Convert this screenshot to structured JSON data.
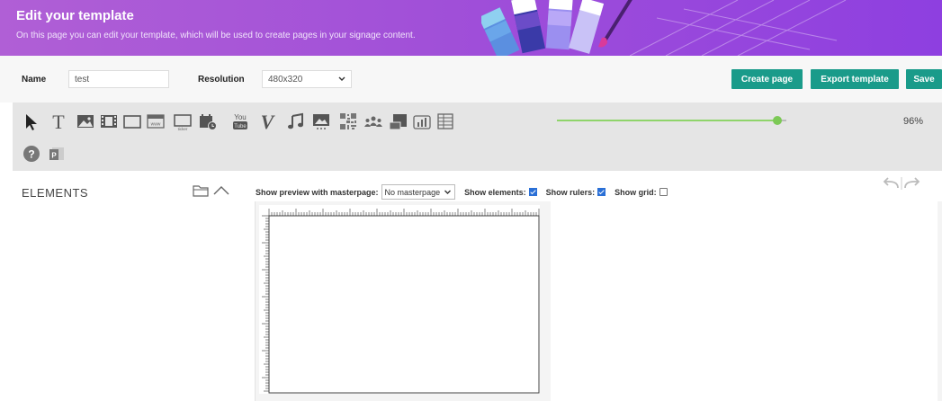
{
  "header": {
    "title": "Edit your template",
    "subtitle": "On this page you can edit your template, which will be used to create pages in your signage content."
  },
  "form": {
    "name_label": "Name",
    "name_value": "test",
    "resolution_label": "Resolution",
    "resolution_value": "480x320"
  },
  "actions": {
    "create_page": "Create page",
    "export_template": "Export template",
    "save": "Save"
  },
  "toolbar": {
    "tools": [
      "pointer-icon",
      "text-icon",
      "image-icon",
      "video-icon",
      "rectangle-icon",
      "webpage-icon",
      "ticker-icon",
      "calendar-icon",
      "youtube-icon",
      "vimeo-icon",
      "audio-icon",
      "slideshow-icon",
      "qrcode-icon",
      "social-icon",
      "chart-icon",
      "table-icon",
      "help-icon",
      "powerpoint-icon"
    ],
    "zoom": "96%",
    "zoom_level": 0.96
  },
  "panel": {
    "elements_title": "ELEMENTS",
    "preview_label": "Show preview with masterpage:",
    "masterpage_value": "No masterpage",
    "show_elements_label": "Show elements:",
    "show_elements": true,
    "show_rulers_label": "Show rulers:",
    "show_rulers": true,
    "show_grid_label": "Show grid:",
    "show_grid": false
  },
  "colors": {
    "header": "#a150d8",
    "button": "#1a9b8a",
    "slider": "#7cc956",
    "checkbox": "#2a6fd6"
  }
}
